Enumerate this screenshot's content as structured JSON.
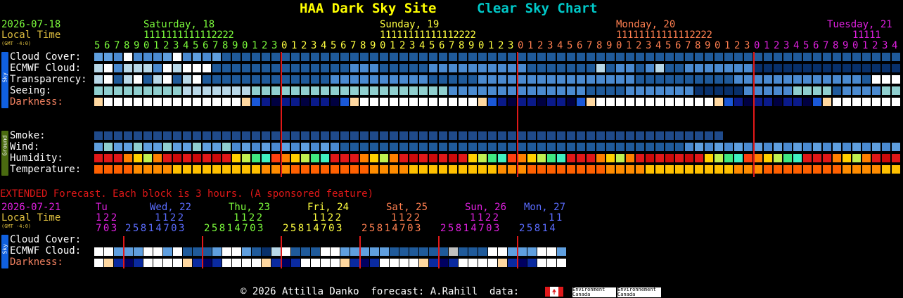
{
  "header": {
    "site_title": "HAA Dark Sky Site",
    "chart_link": "Clear Sky Chart",
    "colors": {
      "site_title": "#ffff00",
      "chart_link": "#00c8c8"
    }
  },
  "main": {
    "date": "2026-07-18",
    "local_time_label": "Local Time",
    "gmt_label": "(GMT -4:0)",
    "day_labels": [
      {
        "text": "Saturday, 18",
        "color": "#7cfc3c"
      },
      {
        "text": "Sunday, 19",
        "color": "#ffff40"
      },
      {
        "text": "Monday, 20",
        "color": "#ff7f50"
      },
      {
        "text": "Tuesday, 21",
        "color": "#e020e0"
      }
    ],
    "hour_tens_saturday": "1111111111112222",
    "hour_tens_sunday": "11111111111112222",
    "hour_tens_monday": "11111111111112222",
    "hour_tens_tuesday": "11111",
    "hours_row": "5678901234567890123012345678901234567890123012345678901234567890123012345678901234",
    "sky_tab": "Sky",
    "ground_tab": "Ground",
    "sky_rows": [
      {
        "label": "Cloud Cover:",
        "color": "#ffffff",
        "cells": "aabwbbbawbabaccccccccccccccccccccccccccccccccccccccccccccccccccccccccccccccccccccccccccccccccccccccccccccccccccccwwwwwwwwwwwwwwwwwwww"
      },
      {
        "label": "ECMWF Cloud:",
        "color": "#ffffff",
        "cells": "gwbgggbwgwwwccccccccccccccbbbcccccbbbbbbbbbbcccccccgcbbcbgccbbbbbbbdddddddddddddddwwwwwwwwwgggggggg"
      },
      {
        "label": "Transparency:",
        "color": "#ffffff",
        "cells": "gwcgwcgwcgwcccccccccccccbbbbbbbbbbcccccbbbbbbbbbbbbbbbbccccccccccbbbbbbbbbbbbbcwwwwwwwwww"
      },
      {
        "label": "Seeing:",
        "color": "#ffffff",
        "cells": "tttttttttgggggggttttttttttttttttttttbbbbbbbbbbbbbbccccbbbbbbbdddddbbbbbttttcbbbbtttwwwwwwwww"
      },
      {
        "label": "Darkness:",
        "color": "#f08060",
        "cells": "dark_row"
      }
    ],
    "ground_rows": [
      {
        "label": "Smoke:",
        "color": "#ffffff",
        "cells": "smoke"
      },
      {
        "label": "Wind:",
        "color": "#ffffff",
        "cells": "wind"
      },
      {
        "label": "Humidity:",
        "color": "#ffffff",
        "cells": "hum"
      },
      {
        "label": "Temperature:",
        "color": "#ffffff",
        "cells": "temp"
      }
    ]
  },
  "extended": {
    "heading": "EXTENDED Forecast. Each block is 3 hours. (A sponsored feature)",
    "date": "2026-07-21",
    "local_time_label": "Local Time",
    "gmt_label": "(GMT -4:0)",
    "days": [
      {
        "text": "Tu",
        "color": "#e020e0",
        "tens": "1 2 2",
        "hours": "7 0 3"
      },
      {
        "text": "Wed, 22",
        "color": "#5a6cff",
        "tens": "1 1 2 2",
        "hours": "2 5 8 1 4 7 0 3"
      },
      {
        "text": "Thu, 23",
        "color": "#7cfc3c",
        "tens": "1 1 2 2",
        "hours": "2 5 8 1 4 7 0 3"
      },
      {
        "text": "Fri, 24",
        "color": "#ffff40",
        "tens": "1 1 2 2",
        "hours": "2 5 8 1 4 7 0 3"
      },
      {
        "text": "Sat, 25",
        "color": "#ff7f50",
        "tens": "1 1 2 2",
        "hours": "2 5 8 1 4 7 0 3"
      },
      {
        "text": "Sun, 26",
        "color": "#e020e0",
        "tens": "1 1 2 2",
        "hours": "2 5 8 1 4 7 0 3"
      },
      {
        "text": "Mon, 27",
        "color": "#5a6cff",
        "tens": "1 1",
        "hours": "2 5 8 1 4"
      }
    ],
    "rows": [
      {
        "label": "Cloud Cover:",
        "color": "#ffffff"
      },
      {
        "label": "ECMWF Cloud:",
        "color": "#ffffff"
      },
      {
        "label": "Darkness:",
        "color": "#f08060"
      }
    ]
  },
  "footer": {
    "copyright": "© 2026 Attilla Danko  forecast: A.Rahill  data:",
    "logo_text_1": "Environment\nCanada",
    "logo_text_2": "Environnement\nCanada"
  }
}
